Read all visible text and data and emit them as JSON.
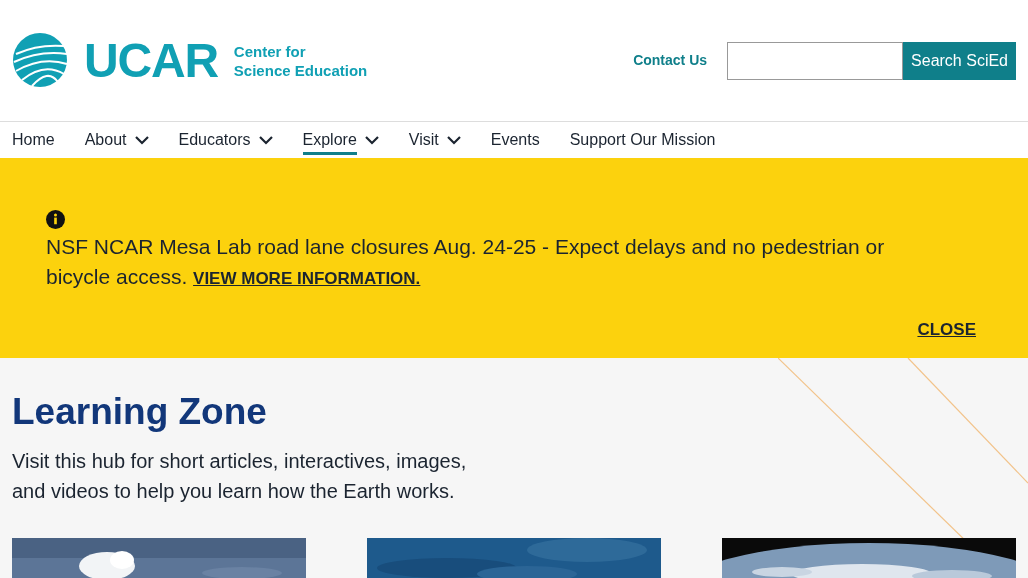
{
  "header": {
    "logo_text": "UCAR",
    "subtitle_lines": [
      "Center for",
      "Science Education"
    ],
    "contact_link": "Contact Us",
    "search": {
      "button": "Search SciEd"
    }
  },
  "nav": [
    {
      "label": "Home",
      "has_menu": false,
      "selected": false
    },
    {
      "label": "About",
      "has_menu": true,
      "selected": false
    },
    {
      "label": "Educators",
      "has_menu": true,
      "selected": false
    },
    {
      "label": "Explore",
      "has_menu": true,
      "selected": true
    },
    {
      "label": "Visit",
      "has_menu": true,
      "selected": false
    },
    {
      "label": "Events",
      "has_menu": false,
      "selected": false
    },
    {
      "label": "Support Our Mission",
      "has_menu": false,
      "selected": false
    }
  ],
  "alert": {
    "message": "NSF NCAR Mesa Lab road lane closures Aug. 24-25 - Expect delays and no pedestrian or bicycle access.",
    "link": "VIEW MORE INFORMATION.",
    "close": "CLOSE"
  },
  "hero": {
    "title": "Learning Zone",
    "description": "Visit this hub for short articles, interactives, images, and videos to help you learn how the Earth works."
  }
}
